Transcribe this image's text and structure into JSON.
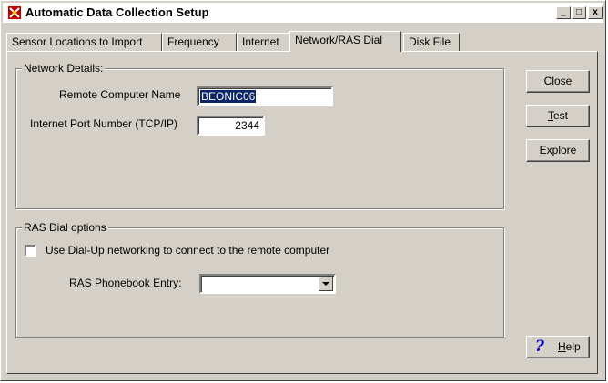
{
  "window": {
    "title": "Automatic Data Collection Setup",
    "controls": {
      "minimize": "_",
      "maximize": "□",
      "close": "x"
    }
  },
  "tabs": [
    {
      "label": "Sensor Locations to Import",
      "active": false
    },
    {
      "label": "Frequency",
      "active": false
    },
    {
      "label": "Internet",
      "active": false
    },
    {
      "label": "Network/RAS Dial",
      "active": true
    },
    {
      "label": "Disk File",
      "active": false
    }
  ],
  "network": {
    "group_label": "Network Details:",
    "remote_label": "Remote Computer Name",
    "remote_value": "BEONIC06",
    "port_label": "Internet Port Number (TCP/IP)",
    "port_value": "2344"
  },
  "ras": {
    "group_label": "RAS Dial options",
    "checkbox_label": "Use Dial-Up networking to connect to the remote computer",
    "checkbox_checked": false,
    "phonebook_label": "RAS Phonebook Entry:",
    "phonebook_value": ""
  },
  "buttons": {
    "close_first": "C",
    "close_rest": "lose",
    "test_first": "T",
    "test_rest": "est",
    "explore": "Explore",
    "help_first": "H",
    "help_rest": "elp",
    "help_icon": "?"
  },
  "colors": {
    "title_bg": "#ffffff",
    "face": "#d4d0c8",
    "selection": "#0a246a",
    "help_icon": "#0000cc"
  }
}
